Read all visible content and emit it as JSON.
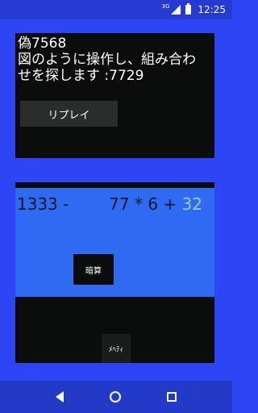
{
  "status_bar": {
    "network_label": "3G",
    "time": "12:25",
    "icons": [
      "signal-icon",
      "battery-icon"
    ]
  },
  "question": {
    "line1": "偽7568",
    "line2": "図のように操作し、組み合わ",
    "line3": "せを探します :7729"
  },
  "replay_button": {
    "label": "リプレイ"
  },
  "formula": {
    "left": "1333 -",
    "right_main": "77 * 6 +",
    "right_highlight": "32",
    "highlight_color": "#a9c7ff"
  },
  "calc_button": {
    "label": "暗算"
  },
  "menu_button": {
    "label": "ﾒﾍﾃｨ"
  },
  "nav_bar": {
    "icons": [
      "back-icon",
      "home-icon",
      "recent-apps-icon"
    ]
  },
  "colors": {
    "background": "#2d45f5",
    "panel": "#0a0d0c",
    "formula_area": "#2e6bf2"
  }
}
